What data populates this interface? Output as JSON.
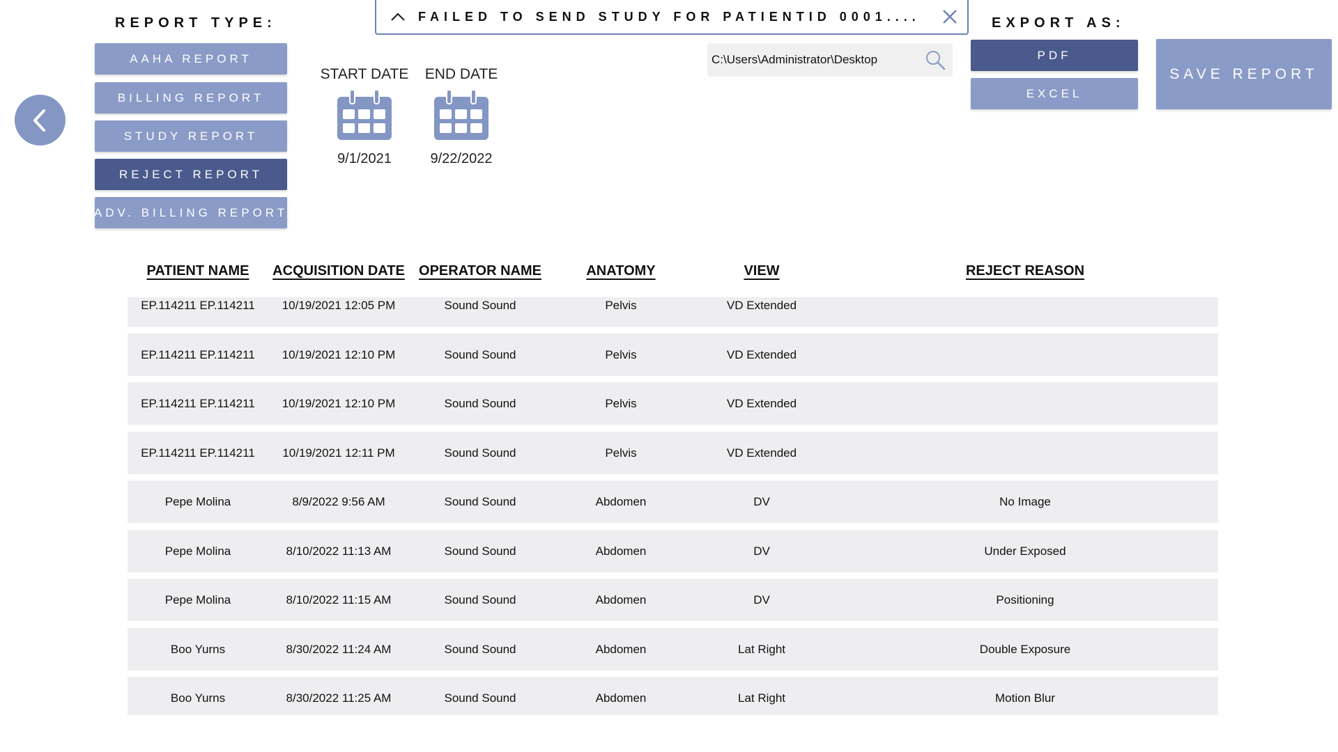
{
  "report_type": {
    "title": "REPORT TYPE:",
    "buttons": [
      {
        "label": "AAHA REPORT",
        "active": false
      },
      {
        "label": "BILLING REPORT",
        "active": false
      },
      {
        "label": "STUDY REPORT",
        "active": false
      },
      {
        "label": "REJECT REPORT",
        "active": true
      },
      {
        "label": "ADV. BILLING REPORT",
        "active": false
      }
    ]
  },
  "dates": {
    "start_label": "START DATE",
    "start_value": "9/1/2021",
    "end_label": "END DATE",
    "end_value": "9/22/2022"
  },
  "notification": {
    "text": "FAILED TO SEND STUDY FOR PATIENTID 0001...."
  },
  "export_path": {
    "value": "C:\\Users\\Administrator\\Desktop"
  },
  "export": {
    "title": "EXPORT AS:",
    "pdf_label": "PDF",
    "excel_label": "EXCEL",
    "selected": "PDF",
    "save_label": "SAVE REPORT"
  },
  "colors": {
    "button": "#8a9bc7",
    "button_active": "#4a5a8c",
    "row_bg": "#eeeef0"
  },
  "table": {
    "headers": [
      "PATIENT NAME",
      "ACQUISITION DATE",
      "OPERATOR NAME",
      "ANATOMY",
      "VIEW",
      "REJECT REASON"
    ],
    "rows": [
      {
        "patient": "EP.114211 EP.114211",
        "date": "10/19/2021 12:05 PM",
        "operator": "Sound  Sound",
        "anatomy": "Pelvis",
        "view": "VD Extended",
        "reason": ""
      },
      {
        "patient": "EP.114211 EP.114211",
        "date": "10/19/2021 12:10 PM",
        "operator": "Sound  Sound",
        "anatomy": "Pelvis",
        "view": "VD Extended",
        "reason": ""
      },
      {
        "patient": "EP.114211 EP.114211",
        "date": "10/19/2021 12:10 PM",
        "operator": "Sound  Sound",
        "anatomy": "Pelvis",
        "view": "VD Extended",
        "reason": ""
      },
      {
        "patient": "EP.114211 EP.114211",
        "date": "10/19/2021 12:11 PM",
        "operator": "Sound  Sound",
        "anatomy": "Pelvis",
        "view": "VD Extended",
        "reason": ""
      },
      {
        "patient": "Pepe Molina",
        "date": "8/9/2022 9:56 AM",
        "operator": "Sound  Sound",
        "anatomy": "Abdomen",
        "view": "DV",
        "reason": "No Image"
      },
      {
        "patient": "Pepe Molina",
        "date": "8/10/2022 11:13 AM",
        "operator": "Sound  Sound",
        "anatomy": "Abdomen",
        "view": "DV",
        "reason": "Under Exposed"
      },
      {
        "patient": "Pepe Molina",
        "date": "8/10/2022 11:15 AM",
        "operator": "Sound  Sound",
        "anatomy": "Abdomen",
        "view": "DV",
        "reason": "Positioning"
      },
      {
        "patient": "Boo Yurns",
        "date": "8/30/2022 11:24 AM",
        "operator": "Sound  Sound",
        "anatomy": "Abdomen",
        "view": "Lat Right",
        "reason": "Double Exposure"
      },
      {
        "patient": "Boo Yurns",
        "date": "8/30/2022 11:25 AM",
        "operator": "Sound  Sound",
        "anatomy": "Abdomen",
        "view": "Lat Right",
        "reason": "Motion Blur"
      }
    ]
  }
}
